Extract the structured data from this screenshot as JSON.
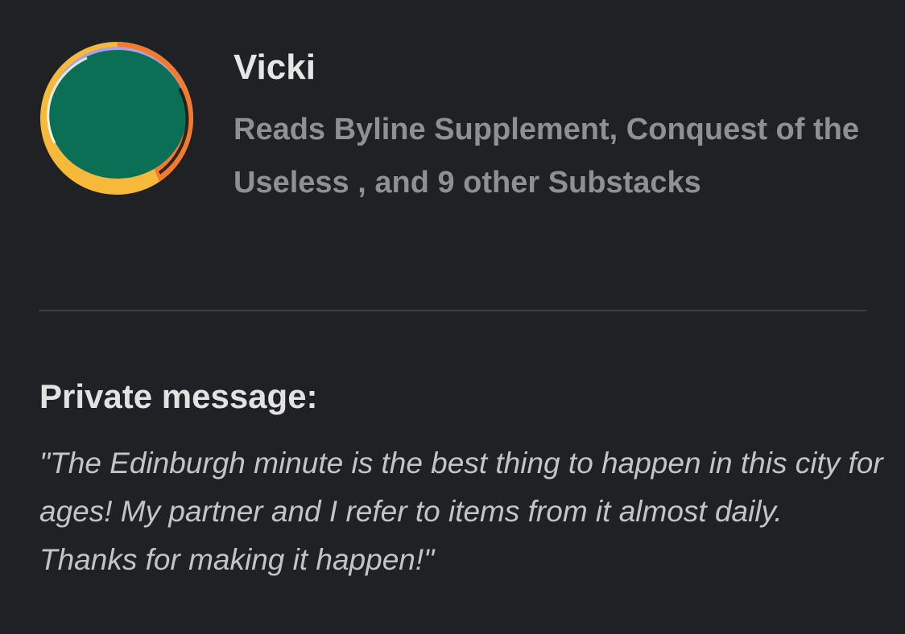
{
  "subscriber": {
    "name": "Vicki",
    "reads_text": "Reads Byline Supplement, Conquest of the Useless , and 9 other Substacks",
    "avatar_icon": "circle-avatar-icon",
    "avatar_colors": {
      "main": "#0b6f56",
      "rim_orange": "#f47a2e",
      "rim_yellow": "#f7b93a",
      "rim_lilac": "#a9a2e6"
    }
  },
  "message": {
    "label": "Private message:",
    "text": "\"The Edinburgh minute is the best thing to happen in this city for ages! My partner and I refer to items from it almost daily. Thanks for making it happen!\""
  }
}
